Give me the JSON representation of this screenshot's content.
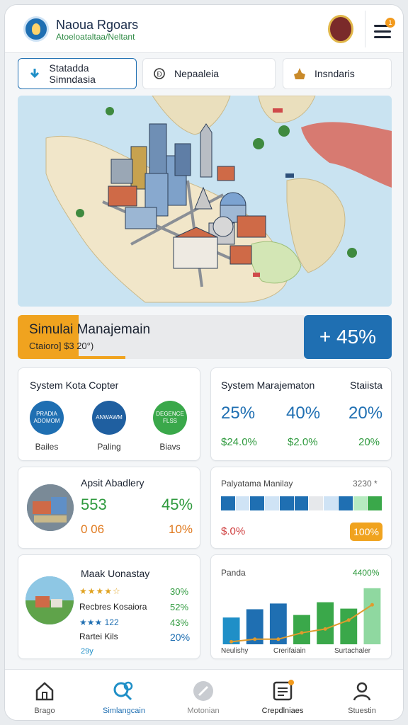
{
  "header": {
    "title": "Naoua Rgoars",
    "subtitle": "Atoeloataltaa/Neltant",
    "notification_count": "1"
  },
  "tabs": [
    {
      "label": "Statadda Simndasia",
      "icon": "download-icon",
      "active": true
    },
    {
      "label": "Nepaaleia",
      "icon": "currency-icon",
      "active": false
    },
    {
      "label": "Insndaris",
      "icon": "temple-icon",
      "active": false
    }
  ],
  "banner": {
    "title": "Simulai Manajemain",
    "subtitle": "Ctaioro] $3 20°)",
    "badge": "+ 45%"
  },
  "card_system_kota": {
    "title": "System Kota Copter",
    "items": [
      {
        "circle_text": "PRADIA ADOMOM",
        "label": "Bailes",
        "color": "#1f6fb2"
      },
      {
        "circle_text": "ANWAWM",
        "label": "Paling",
        "color": "#1f5fa0"
      },
      {
        "circle_text": "DEGENCE FLSS",
        "label": "Biavs",
        "color": "#3aa84a"
      }
    ]
  },
  "card_system_manajemation": {
    "title": "System Marajematon",
    "title_right": "Staiista",
    "big": [
      "25%",
      "40%",
      "20%"
    ],
    "small": [
      "$24.0%",
      "$2.0%",
      "20%"
    ]
  },
  "card_apsit": {
    "title": "Apsit Abadlery",
    "v1": "553",
    "v2": "45%",
    "v3": "0 06",
    "v4": "10%"
  },
  "card_palyatama": {
    "title": "Palyatama Manilay",
    "value": "3230 *",
    "bottom_left": "$.0%",
    "bottom_right": "100%",
    "segments": [
      "#1f6fb2",
      "#cfe3f5",
      "#1f6fb2",
      "#cfe3f5",
      "#1f6fb2",
      "#1f6fb2",
      "#e6e8eb",
      "#cfe3f5",
      "#1f6fb2",
      "#b7ebc1",
      "#3aa84a"
    ]
  },
  "card_maak": {
    "title": "Maak Uonastay",
    "rows": [
      {
        "label": "",
        "stars": "★★★★☆",
        "value": "30%"
      },
      {
        "label": "Recbres Kosaiora",
        "stars": "",
        "value": "52%"
      },
      {
        "label": "★★★ 122",
        "stars": "",
        "value": "43%"
      },
      {
        "label": "Rartei Kils",
        "stars": "",
        "value": "20%"
      }
    ],
    "footer": "29y"
  },
  "card_panda": {
    "title": "Panda",
    "value": "4400%",
    "xlabels": [
      "Neulishy",
      "Crerifaiain",
      "Surtachaler"
    ]
  },
  "chart_data": {
    "type": "bar",
    "title": "Panda",
    "categories": [
      "Neulishy",
      "",
      "Crerifaiain",
      "",
      "",
      "",
      "Surtachaler"
    ],
    "series": [
      {
        "values": [
          42,
          55,
          64,
          46,
          66,
          56,
          88
        ]
      },
      {
        "values": [
          4,
          8,
          8,
          18,
          24,
          38,
          62
        ]
      }
    ],
    "bar_colors": [
      "#1f8fc7",
      "#1f6fb2",
      "#1f6fb2",
      "#3aa84a",
      "#3aa84a",
      "#3aa84a",
      "#8fd8a0"
    ],
    "line_color": "#e09b2d",
    "ylim": [
      0,
      100
    ]
  },
  "nav": [
    {
      "label": "Brago",
      "icon": "home-icon"
    },
    {
      "label": "Simlangcain",
      "icon": "search-people-icon",
      "active": true
    },
    {
      "label": "Motonian",
      "icon": "compass-icon"
    },
    {
      "label": "Crepdlniaes",
      "icon": "report-icon"
    },
    {
      "label": "Stuestin",
      "icon": "user-icon"
    }
  ]
}
